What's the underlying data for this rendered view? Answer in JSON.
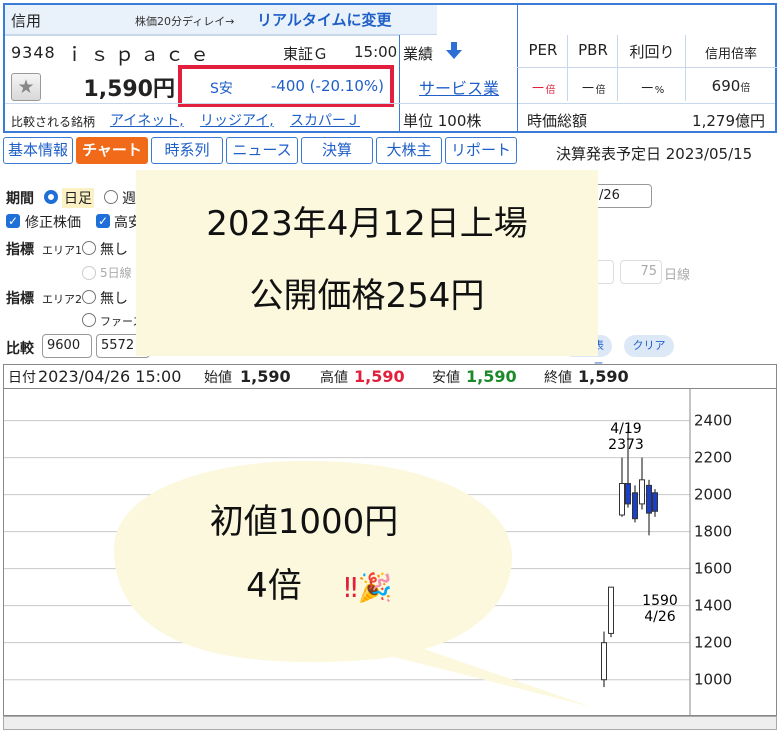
{
  "header": {
    "margin_type": "信用",
    "delay_note": "株価20分ディレイ→",
    "realtime_link": "リアルタイムに変更",
    "code": "9348",
    "name": "ｉｓｐａｃｅ",
    "market": "東証Ｇ",
    "time": "15:00",
    "price": "1,590円",
    "stop_label": "S安",
    "change": "-400 (-20.10%)",
    "compare_label": "比較される銘柄",
    "compare_links": [
      "アイネット,",
      "リッジアイ,",
      "スカパーＪ"
    ],
    "performance_label": "業績",
    "sector": "サービス業",
    "unit": "単位 100株",
    "metrics": [
      {
        "label": "PER",
        "value": "－",
        "unit": "倍"
      },
      {
        "label": "PBR",
        "value": "－",
        "unit": "倍"
      },
      {
        "label": "利回り",
        "value": "－",
        "unit": "%"
      },
      {
        "label": "信用倍率",
        "value": "690",
        "unit": "倍"
      }
    ],
    "market_cap_label": "時価総額",
    "market_cap": "1,279億円",
    "accent_color": "#3a7bd5",
    "stop_color": "#e21f3c"
  },
  "tabs": [
    {
      "label": "基本情報",
      "active": false
    },
    {
      "label": "チャート",
      "active": true
    },
    {
      "label": "時系列",
      "active": false
    },
    {
      "label": "ニュース",
      "active": false
    },
    {
      "label": "決算",
      "active": false
    },
    {
      "label": "大株主",
      "active": false
    },
    {
      "label": "リポート",
      "active": false
    }
  ],
  "earnings_date": "決算発表予定日 2023/05/15",
  "settings": {
    "period_label": "期間",
    "period_daily": "日足",
    "period_weekly": "週",
    "end_date_fragment": "/26",
    "adjusted_label": "修正株価",
    "high_fragment": "高安",
    "indicator_label": "指標",
    "area1_label": "エリア1",
    "area2_label": "エリア2",
    "none_label": "無し",
    "ma5_fragment": "5日線",
    "ma_75": "75",
    "day_line": "日線",
    "first_fragment": "ファースト",
    "compare_label": "比較",
    "compare_codes": [
      "9600",
      "5572"
    ],
    "apply_fragment": "表示",
    "clear_label": "クリア"
  },
  "overlay": {
    "line1": "2023年4月12日上場",
    "line2": "公開価格254円"
  },
  "chart_header": {
    "date_label": "日付",
    "date": "2023/04/26 15:00",
    "open_label": "始値",
    "open": "1,590",
    "high_label": "高値",
    "high": "1,590",
    "low_label": "安値",
    "low": "1,590",
    "close_label": "終値",
    "close": "1,590"
  },
  "bubble": {
    "line1": "初値1000円",
    "line2": "4倍",
    "emoji": "‼🎉"
  },
  "chart_data": {
    "type": "candlestick",
    "y_ticks": [
      1000,
      1200,
      1400,
      1600,
      1800,
      2000,
      2200,
      2400
    ],
    "y_range": [
      820,
      2560
    ],
    "panels": [
      {
        "name": "price",
        "candles": [
          {
            "x": 0,
            "open": 1000,
            "close": 1200,
            "high": 1260,
            "low": 960,
            "color": "#ffffff"
          },
          {
            "x": 1,
            "open": 1250,
            "close": 1500,
            "high": 1500,
            "low": 1230,
            "color": "#ffffff"
          },
          {
            "x": 2,
            "open": 1890,
            "close": 2060,
            "high": 2200,
            "low": 1880,
            "color": "#ffffff"
          },
          {
            "x": 3,
            "open": 2060,
            "close": 1950,
            "high": 2373,
            "low": 1930,
            "color": "#1a3fc8"
          },
          {
            "x": 4,
            "open": 2010,
            "close": 1870,
            "high": 2050,
            "low": 1850,
            "color": "#1a3fc8"
          },
          {
            "x": 5,
            "open": 1950,
            "close": 2080,
            "high": 2200,
            "low": 1920,
            "color": "#ffffff"
          },
          {
            "x": 6,
            "open": 2050,
            "close": 1900,
            "high": 2080,
            "low": 1780,
            "color": "#1a3fc8"
          },
          {
            "x": 7,
            "open": 2010,
            "close": 1910,
            "high": 2030,
            "low": 1880,
            "color": "#1a3fc8"
          }
        ]
      }
    ],
    "annotations": [
      {
        "value": "4/19",
        "label_high": "2373"
      },
      {
        "value": "4/26",
        "label_last": "1590"
      }
    ]
  }
}
